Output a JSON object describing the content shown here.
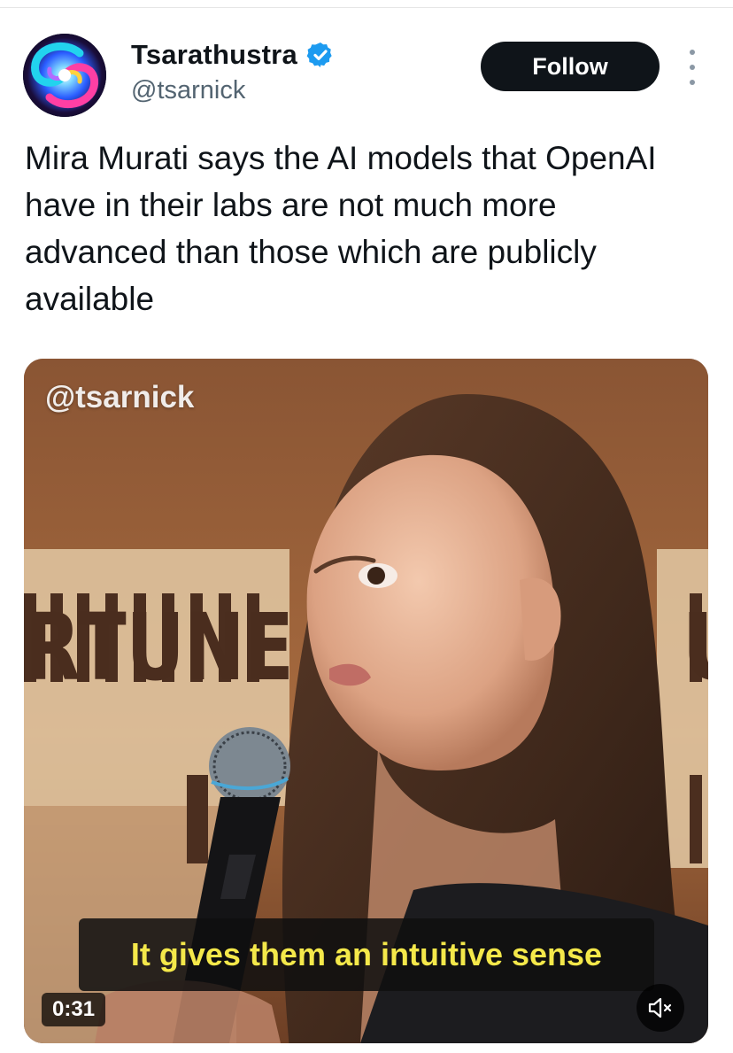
{
  "author": {
    "display_name": "Tsarathustra",
    "handle": "@tsarnick",
    "verified": true,
    "avatar_icon": "swirl-avatar-icon"
  },
  "actions": {
    "follow_label": "Follow",
    "more_icon": "more-dots-icon"
  },
  "tweet": {
    "text": "Mira Murati says the AI models that OpenAI have in their labs are not much more advanced than those which are publicly available"
  },
  "video": {
    "watermark": "@tsarnick",
    "background_sign_left": "RTUNE",
    "background_sign_right": "U",
    "caption": "It gives them an intuitive sense",
    "duration": "0:31",
    "mute_icon": "muted-speaker-icon"
  },
  "colors": {
    "follow_bg": "#0f1419",
    "verified_blue": "#1d9bf0",
    "caption_text": "#f4e84a",
    "handle_gray": "#536471"
  }
}
